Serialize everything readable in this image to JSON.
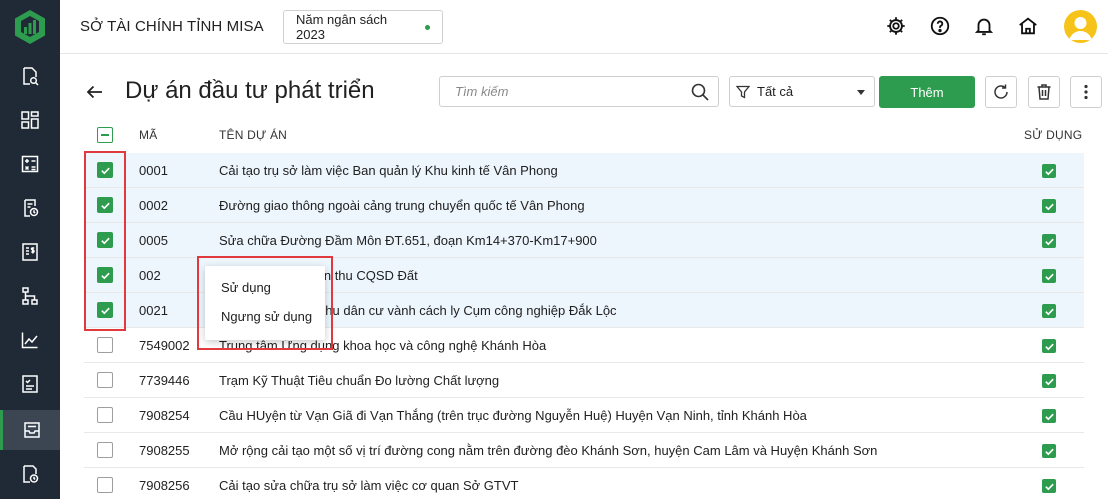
{
  "header": {
    "org_name": "SỞ TÀI CHÍNH TỈNH MISA",
    "budget_year": "Năm ngân sách 2023"
  },
  "page": {
    "title": "Dự án đầu tư phát triển",
    "search_placeholder": "Tìm kiếm",
    "filter_value": "Tất cả",
    "add_label": "Thêm"
  },
  "columns": {
    "code": "MÃ",
    "name": "TÊN DỰ ÁN",
    "in_use": "SỬ DỤNG"
  },
  "rows": [
    {
      "code": "0001",
      "name": "Cải tạo trụ sở làm việc Ban quản lý Khu kinh tế Vân Phong",
      "selected": true
    },
    {
      "code": "0002",
      "name": "Đường giao thông ngoài cảng trung chuyển quốc tế Vân Phong",
      "selected": true
    },
    {
      "code": "0005",
      "name": "Sửa chữa Đường Đầm Môn ĐT.651, đoạn Km14+370-Km17+900",
      "selected": true
    },
    {
      "code": "002",
      "name": "Dự án chi từ nguồn thu CQSD Đất",
      "selected": true
    },
    {
      "code": "0021",
      "name": "Dự án xây dựng Khu dân cư vành cách ly Cụm công nghiệp Đắk Lộc",
      "selected": true
    },
    {
      "code": "7549002",
      "name": "Trung tâm Ứng dụng khoa học và công nghệ Khánh Hòa",
      "selected": false
    },
    {
      "code": "7739446",
      "name": "Trạm Kỹ Thuật Tiêu chuẩn Đo lường Chất lượng",
      "selected": false
    },
    {
      "code": "7908254",
      "name": "Cầu HUyện từ Vạn Giã đi Vạn Thắng (trên trục đường Nguyễn Huệ) Huyện Vạn Ninh, tỉnh Khánh Hòa",
      "selected": false
    },
    {
      "code": "7908255",
      "name": "Mở rộng cải tạo một số vị trí đường cong nằm trên đường đèo Khánh Sơn, huyện Cam Lâm và Huyện Khánh Sơn",
      "selected": false
    },
    {
      "code": "7908256",
      "name": "Cải tạo sửa chữa trụ sở làm việc cơ quan Sở GTVT",
      "selected": false
    }
  ],
  "context_menu": {
    "items": [
      "Sử dụng",
      "Ngưng sử dụng"
    ]
  },
  "colors": {
    "primary_green": "#2e9c4e",
    "sidebar_bg": "#1f2a36",
    "selected_row": "#edf5fd",
    "highlight_red": "#e0393e"
  },
  "icons": {
    "sidebar": [
      "search-report-icon",
      "dashboard-icon",
      "calculator-icon",
      "clock-document-icon",
      "dollar-document-icon",
      "org-chart-icon",
      "line-chart-icon",
      "checklist-icon",
      "inbox-icon",
      "history-icon"
    ],
    "header": [
      "gear-icon",
      "help-icon",
      "bell-icon",
      "home-icon",
      "user-avatar-icon"
    ]
  }
}
